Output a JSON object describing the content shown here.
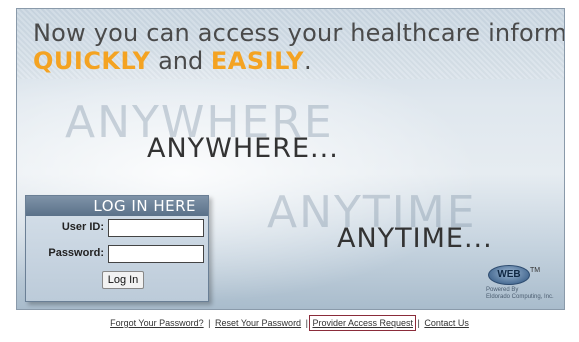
{
  "headline": {
    "line1": "Now you can access your healthcare information",
    "quickly": "QUICKLY",
    "and": " and ",
    "easily": "EASILY",
    "period": "."
  },
  "banner": {
    "ghost1": "ANYWHERE",
    "word1": "ANYWHERE...",
    "ghost2": "ANYTIME",
    "word2": "ANYTIME..."
  },
  "login": {
    "header": "LOG IN HERE",
    "user_label": "User ID:",
    "user_value": "",
    "password_label": "Password:",
    "password_value": "",
    "button": "Log In"
  },
  "logo": {
    "mark": "WEB",
    "tm": "TM",
    "powered": "Powered By",
    "company": "Eldorado Computing, Inc."
  },
  "footer": {
    "links": [
      "Forgot Your Password?",
      "Reset Your Password",
      "Provider Access Request",
      "Contact Us"
    ],
    "separator": "|"
  },
  "colors": {
    "accent": "#f4a322",
    "login_header": "#5a7189",
    "highlight_box": "#8b2c3a"
  }
}
